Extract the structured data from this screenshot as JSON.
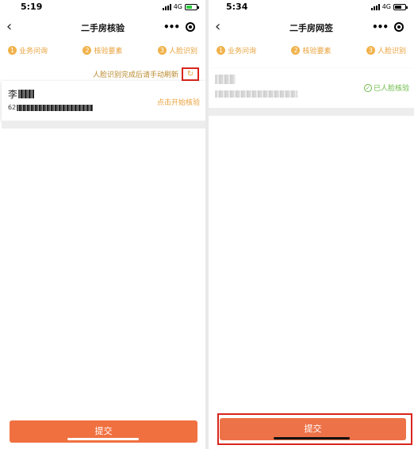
{
  "left_screen": {
    "status": {
      "time": "5:19",
      "network": "4G"
    },
    "nav": {
      "back": "‹",
      "title": "二手房核验"
    },
    "steps": [
      {
        "num": "1",
        "label": "业务问询"
      },
      {
        "num": "2",
        "label": "核验要素"
      },
      {
        "num": "3",
        "label": "人脸识别"
      }
    ],
    "refresh": {
      "hint": "人脸识别完成后请手动刷新",
      "icon": "↻"
    },
    "card": {
      "name_prefix": "李",
      "id_prefix": "62",
      "action": "点击开始核验"
    },
    "submit": "提交"
  },
  "right_screen": {
    "status": {
      "time": "5:34",
      "network": "4G"
    },
    "nav": {
      "back": "‹",
      "title": "二手房网签"
    },
    "steps": [
      {
        "num": "1",
        "label": "业务问询"
      },
      {
        "num": "2",
        "label": "核验要素"
      },
      {
        "num": "3",
        "label": "人脸识别"
      }
    ],
    "card": {
      "verified": "已人脸核验",
      "check_icon": "✓"
    },
    "submit": "提交"
  },
  "colors": {
    "accent": "#e8a23c",
    "submit": "#f07040",
    "verified": "#6cbb47",
    "highlight": "#d9251c"
  }
}
